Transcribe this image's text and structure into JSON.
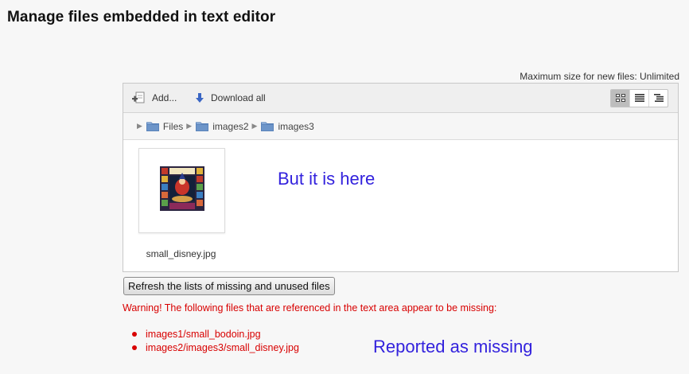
{
  "page": {
    "title": "Manage files embedded in text editor"
  },
  "filemanager": {
    "max_size_label": "Maximum size for new files: Unlimited",
    "toolbar": {
      "add_label": "Add...",
      "download_label": "Download all",
      "add_icon": "add-file-icon",
      "download_icon": "download-arrow-icon",
      "views": [
        "view-icons-icon",
        "view-list-icon",
        "view-tree-icon"
      ],
      "active_view": "view-icons-icon"
    },
    "breadcrumb": [
      "Files",
      "images2",
      "images3"
    ],
    "files": [
      {
        "name": "small_disney.jpg",
        "thumbnail": "disney-thumbnail"
      }
    ]
  },
  "annotations": {
    "here": "But it is here",
    "missing": "Reported as missing"
  },
  "refresh_button_label": "Refresh the lists of missing and unused files",
  "warning_text": "Warning! The following files that are referenced in the text area appear to be missing:",
  "missing_files": [
    "images1/small_bodoin.jpg",
    "images2/images3/small_disney.jpg"
  ],
  "colors": {
    "warning": "#d80000",
    "annotation": "#3322dd",
    "folder": "#6d95c9"
  }
}
